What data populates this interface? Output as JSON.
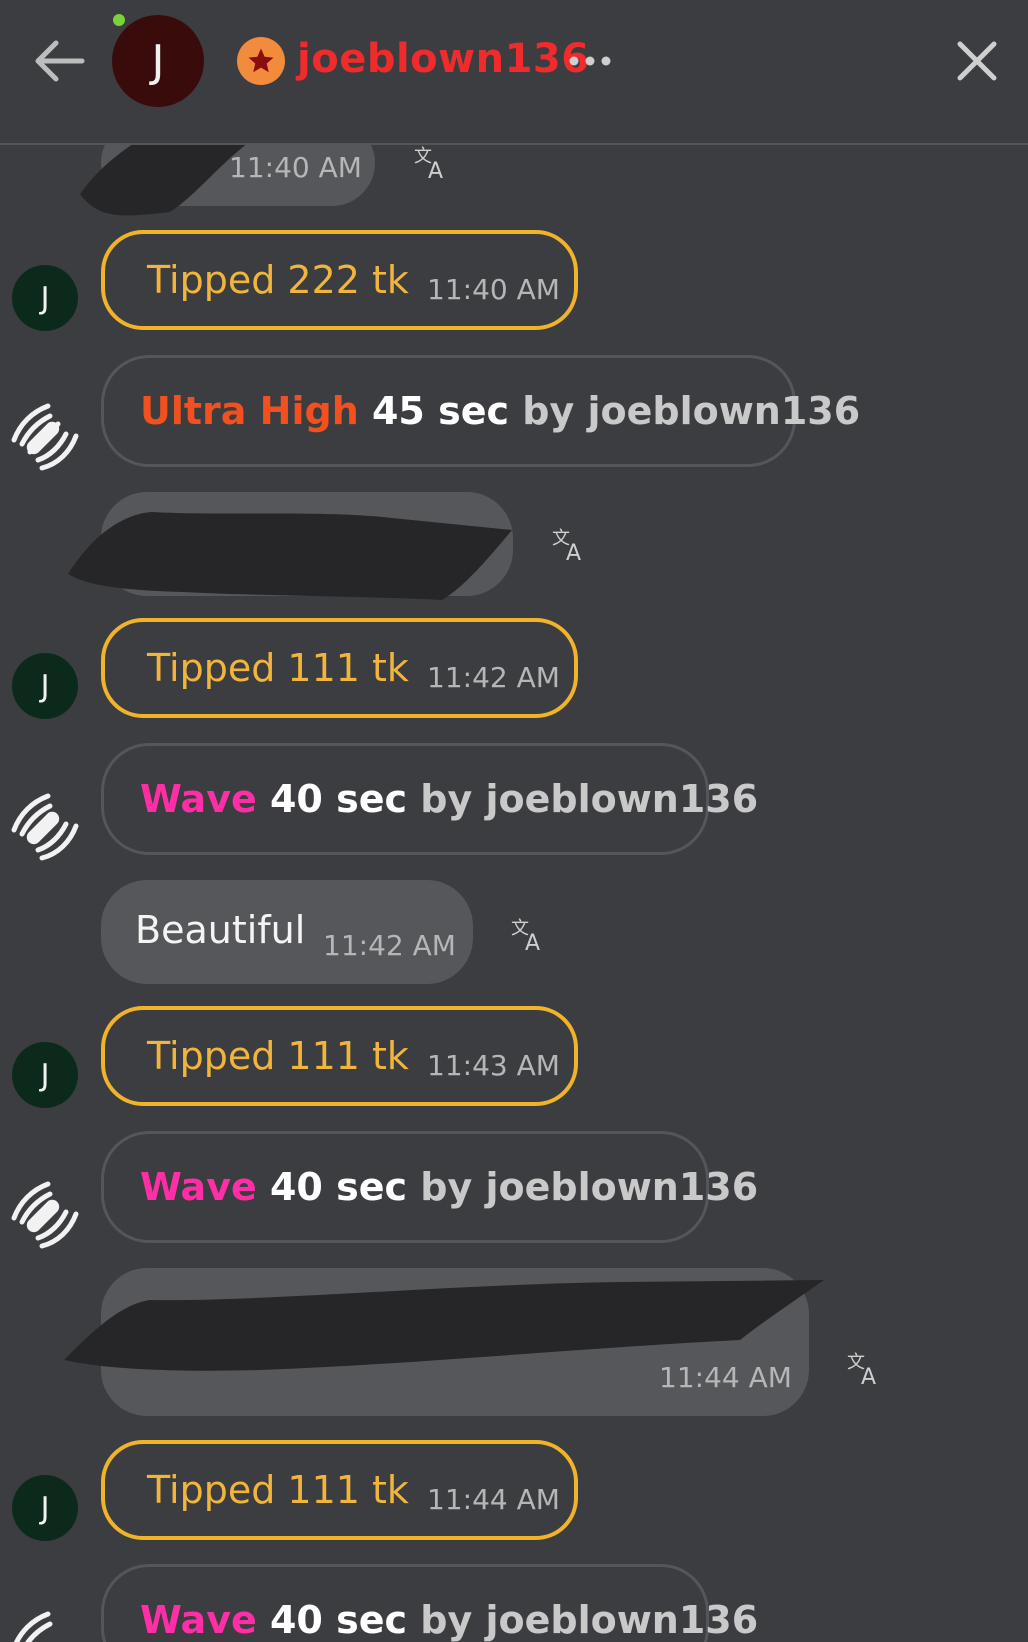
{
  "header": {
    "avatar_initial": "J",
    "username": "joeblown136"
  },
  "messages": [
    {
      "type": "text",
      "text": "",
      "time": "11:40 AM",
      "redacted": true
    },
    {
      "type": "tip",
      "text": "Tipped 222 tk",
      "time": "11:40 AM",
      "avatar_initial": "J"
    },
    {
      "type": "vibe",
      "level": "Ultra High",
      "duration": "45 sec",
      "by_label": "by",
      "user": "joeblown136"
    },
    {
      "type": "text",
      "text": "",
      "time": "",
      "redacted": true
    },
    {
      "type": "tip",
      "text": "Tipped 111 tk",
      "time": "11:42 AM",
      "avatar_initial": "J"
    },
    {
      "type": "vibe",
      "level": "Wave",
      "duration": "40 sec",
      "by_label": "by",
      "user": "joeblown136"
    },
    {
      "type": "text",
      "text": "Beautiful",
      "time": "11:42 AM",
      "redacted": false
    },
    {
      "type": "tip",
      "text": "Tipped 111 tk",
      "time": "11:43 AM",
      "avatar_initial": "J"
    },
    {
      "type": "vibe",
      "level": "Wave",
      "duration": "40 sec",
      "by_label": "by",
      "user": "joeblown136"
    },
    {
      "type": "text",
      "text": "",
      "time": "11:44 AM",
      "redacted": true
    },
    {
      "type": "tip",
      "text": "Tipped 111 tk",
      "time": "11:44 AM",
      "avatar_initial": "J"
    },
    {
      "type": "vibe",
      "level": "Wave",
      "duration": "40 sec",
      "by_label": "by",
      "user": "joeblown136"
    }
  ],
  "colors": {
    "background": "#3c3d41",
    "tip_border": "#f0b32a",
    "username": "#ef2b2b",
    "ultra_high": "#f2501f",
    "wave": "#ff2da6",
    "online": "#7bd33a"
  },
  "icons": [
    "back-arrow-icon",
    "star-icon",
    "more-icon",
    "close-icon",
    "translate-icon",
    "vibration-icon"
  ]
}
